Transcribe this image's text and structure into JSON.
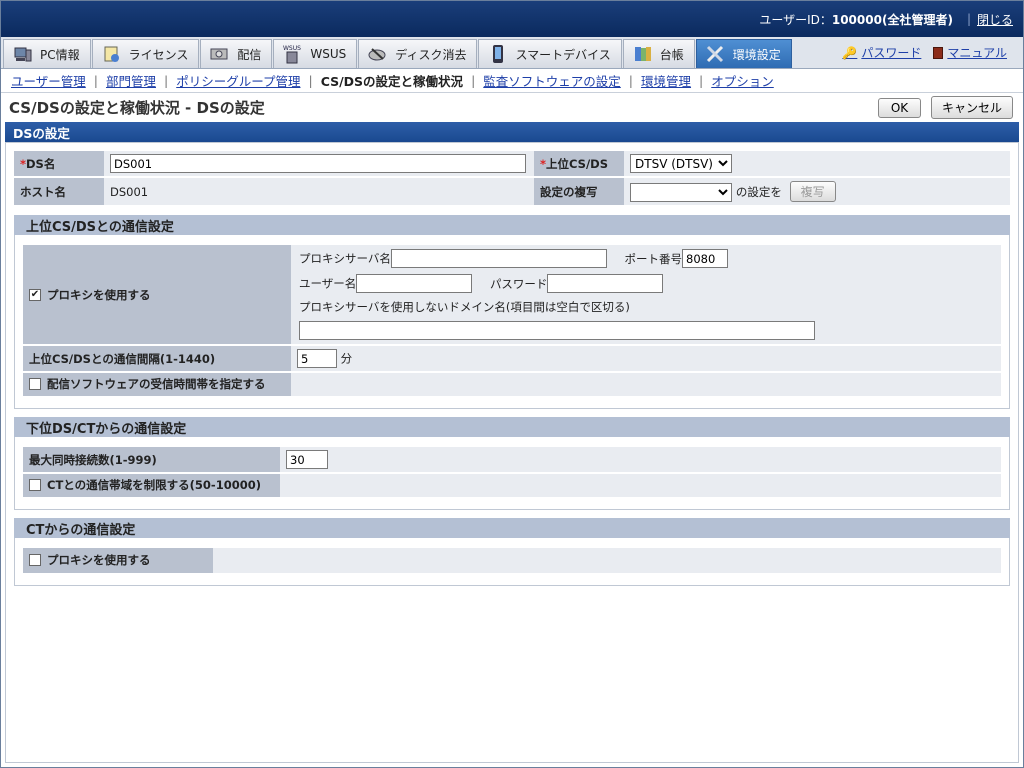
{
  "header": {
    "user_label": "ユーザーID：",
    "user_value": "100000(全社管理者)",
    "close_label": "閉じる"
  },
  "tabs": [
    {
      "label": "PC情報",
      "icon": "pc-icon"
    },
    {
      "label": "ライセンス",
      "icon": "license-icon"
    },
    {
      "label": "配信",
      "icon": "distribution-icon"
    },
    {
      "label": "WSUS",
      "icon": "wsus-icon"
    },
    {
      "label": "ディスク消去",
      "icon": "disk-erase-icon"
    },
    {
      "label": "スマートデバイス",
      "icon": "smart-device-icon"
    },
    {
      "label": "台帳",
      "icon": "ledger-icon"
    },
    {
      "label": "環境設定",
      "icon": "settings-icon"
    }
  ],
  "tab_links": {
    "password": "パスワード",
    "manual": "マニュアル"
  },
  "subnav": {
    "user_mgmt": "ユーザー管理",
    "dept_mgmt": "部門管理",
    "policy_group": "ポリシーグループ管理",
    "current": "CS/DSの設定と稼働状況",
    "monitor_sw": "監査ソフトウェアの設定",
    "env_mgmt": "環境管理",
    "options": "オプション"
  },
  "page": {
    "title": "CS/DSの設定と稼働状況 - DSの設定",
    "ok": "OK",
    "cancel": "キャンセル",
    "section": "DSの設定"
  },
  "basic": {
    "ds_name_label": "DS名",
    "ds_name_value": "DS001",
    "upper_label": "上位CS/DS",
    "upper_value": "DTSV (DTSV)",
    "host_label": "ホスト名",
    "host_value": "DS001",
    "copy_label": "設定の複写",
    "copy_suffix": "の設定を",
    "copy_button": "複写"
  },
  "upper_comm": {
    "title": "上位CS/DSとの通信設定",
    "use_proxy": "プロキシを使用する",
    "proxy_server": "プロキシサーバ名",
    "port": "ポート番号",
    "port_value": "8080",
    "user": "ユーザー名",
    "password": "パスワード",
    "no_proxy": "プロキシサーバを使用しないドメイン名(項目間は空白で区切る)",
    "interval_label": "上位CS/DSとの通信間隔(1-1440)",
    "interval_value": "5",
    "interval_unit": "分",
    "receive_time": "配信ソフトウェアの受信時間帯を指定する"
  },
  "lower_comm": {
    "title": "下位DS/CTからの通信設定",
    "max_conn_label": "最大同時接続数(1-999)",
    "max_conn_value": "30",
    "bandwidth": "CTとの通信帯域を制限する(50-10000)"
  },
  "ct_comm": {
    "title": "CTからの通信設定",
    "use_proxy": "プロキシを使用する"
  }
}
